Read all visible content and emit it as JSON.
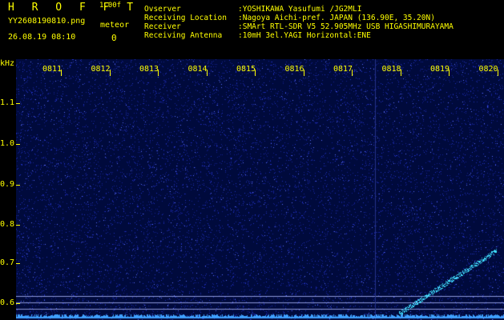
{
  "header": {
    "app_title": "H R O F F T",
    "version": "1.00f",
    "file_name": "YY2608190810.png",
    "timestamp": "26.08.19 08:10",
    "meteor_label": "meteor",
    "meteor_count": "0"
  },
  "info": [
    {
      "key": "Ovserver",
      "value": ":YOSHIKAWA Yasufumi /JG2MLI"
    },
    {
      "key": "Receiving Location",
      "value": ":Nagoya Aichi-pref. JAPAN (136.90E, 35.20N)"
    },
    {
      "key": "Receiver",
      "value": ":SMArt RTL-SDR V5 52.905MHz USB HIGASHIMURAYAMA"
    },
    {
      "key": "Receiving Antenna",
      "value": ":10mH 3el.YAGI Horizontal:ENE"
    }
  ],
  "axis": {
    "unit": "kHz",
    "time_labels": [
      "0811",
      "0812",
      "0813",
      "0814",
      "0815",
      "0816",
      "0817",
      "0818",
      "0819",
      "0820"
    ],
    "freq_labels": [
      "1.1",
      "1.0",
      "0.9",
      "0.8",
      "0.7",
      "0.6"
    ]
  },
  "colors": {
    "label": "#ffff00",
    "background": "#000a3c",
    "noise": "#2030c0",
    "signal": "#40e0ff"
  }
}
